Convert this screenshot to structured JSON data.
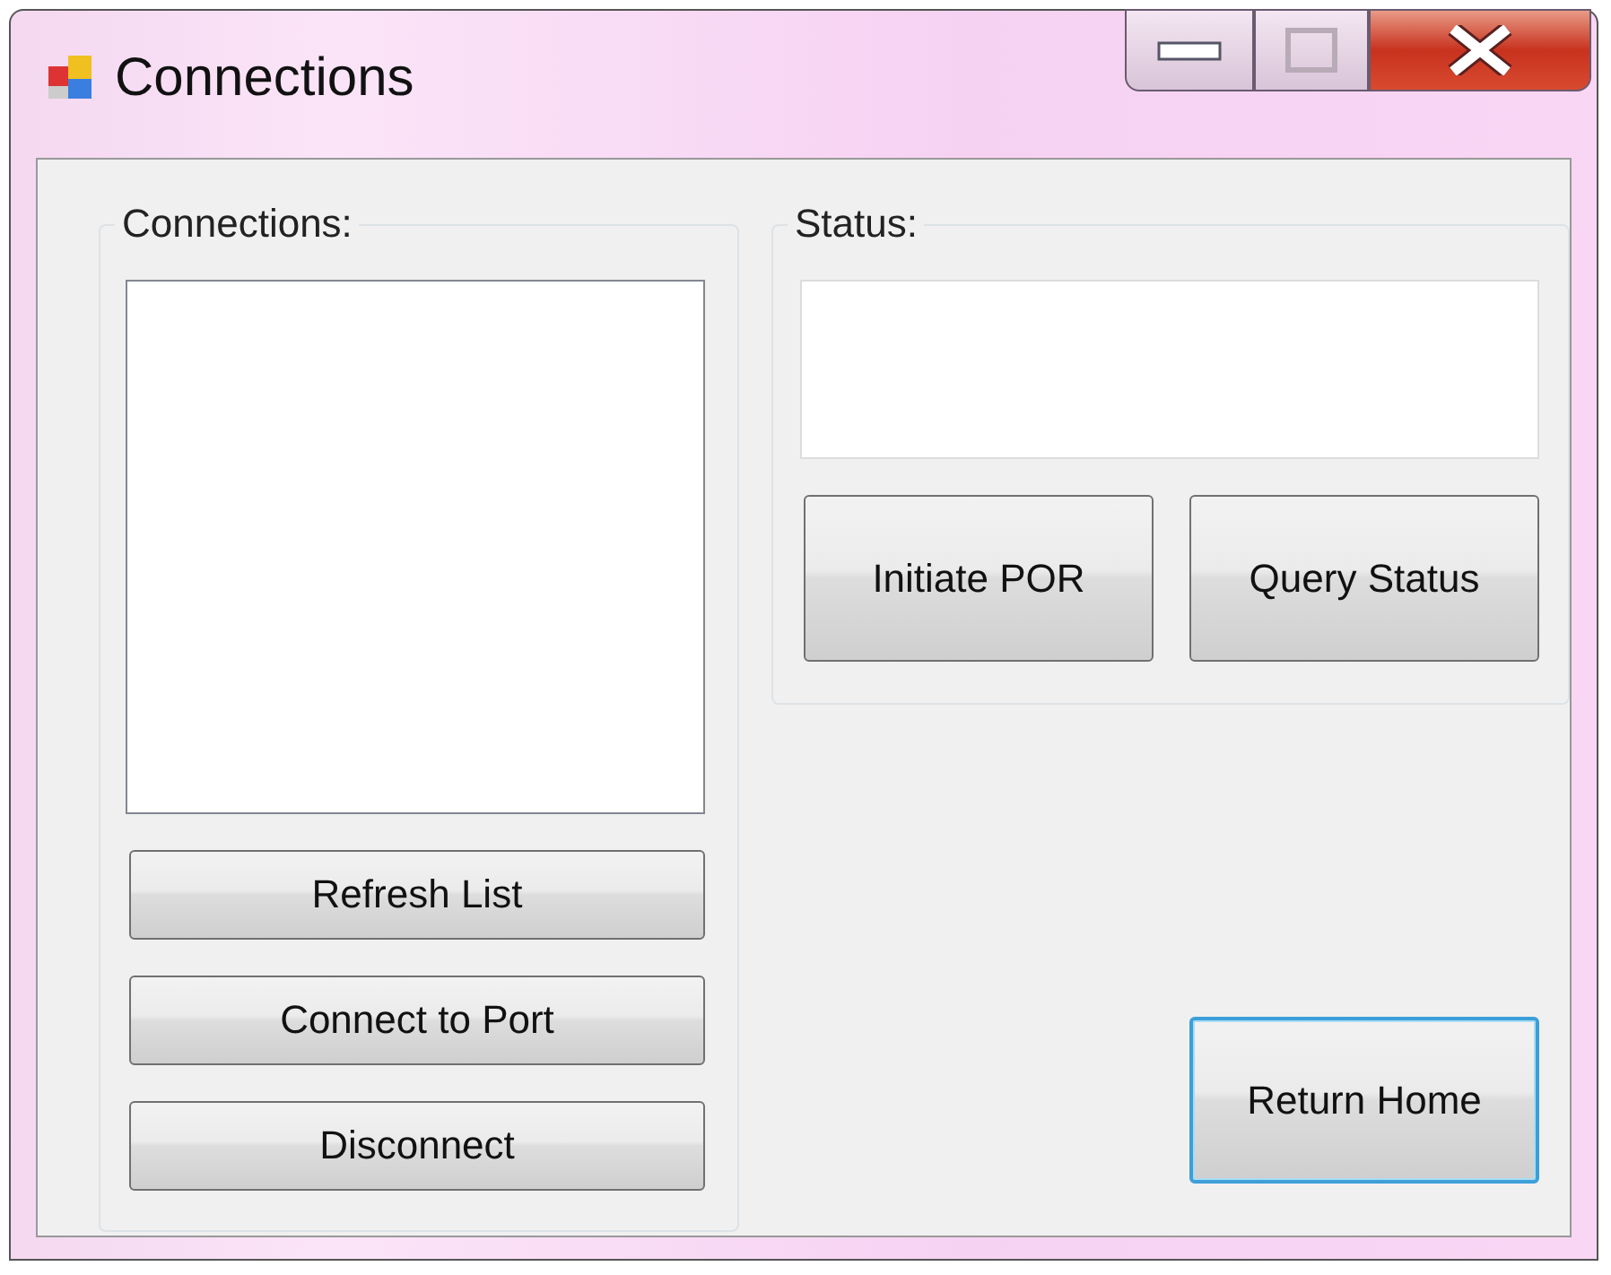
{
  "window": {
    "title": "Connections"
  },
  "connections_group": {
    "label": "Connections:",
    "buttons": [
      {
        "label": "Refresh List",
        "focused": false
      },
      {
        "label": "Connect to Port",
        "focused": false
      },
      {
        "label": "Disconnect",
        "focused": false
      }
    ]
  },
  "status_group": {
    "label": "Status:",
    "buttons": [
      {
        "label": "Initiate POR",
        "focused": false
      },
      {
        "label": "Query Status",
        "focused": false
      }
    ]
  },
  "return_button": {
    "label": "Return Home",
    "focused": true
  }
}
